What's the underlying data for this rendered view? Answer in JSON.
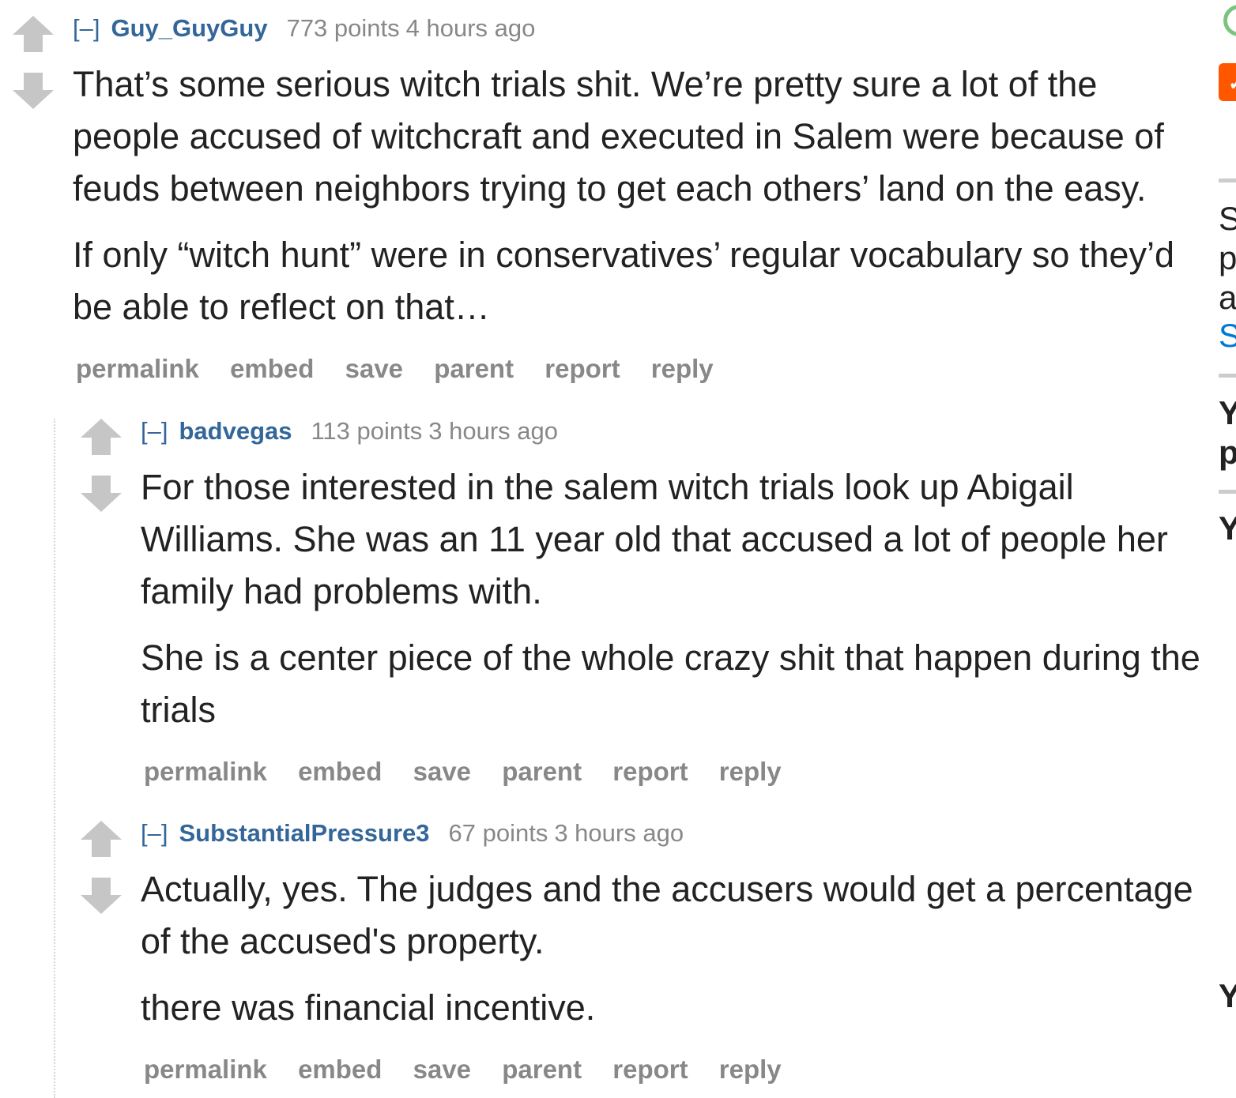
{
  "comments": [
    {
      "expand": "[–]",
      "author": "Guy_GuyGuy",
      "score": "773 points",
      "time": "4 hours ago",
      "paragraphs": [
        "That’s some serious witch trials shit. We’re pretty sure a lot of the people accused of witchcraft and executed in Salem were because of feuds between neighbors trying to get each others’ land on the easy.",
        "If only “witch hunt” were in conservatives’ regular vocabulary so they’d be able to reflect on that…"
      ],
      "buttons": [
        "permalink",
        "embed",
        "save",
        "parent",
        "report",
        "reply"
      ]
    },
    {
      "expand": "[–]",
      "author": "badvegas",
      "score": "113 points",
      "time": "3 hours ago",
      "paragraphs": [
        "For those interested in the salem witch trials look up Abigail Williams. She was an 11 year old that accused a lot of people her family had problems with.",
        "She is a center piece of the whole crazy shit that happen during the trials"
      ],
      "buttons": [
        "permalink",
        "embed",
        "save",
        "parent",
        "report",
        "reply"
      ]
    },
    {
      "expand": "[–]",
      "author": "SubstantialPressure3",
      "score": "67 points",
      "time": "3 hours ago",
      "paragraphs": [
        "Actually, yes. The judges and the accusers would get a percentage of the accused's property.",
        "there was financial incentive."
      ],
      "buttons": [
        "permalink",
        "embed",
        "save",
        "parent",
        "report",
        "reply"
      ]
    }
  ],
  "sidebar": {
    "check_icon": "✓",
    "fragments": [
      "S",
      "p",
      "a",
      "S",
      "Y",
      "p",
      "Y",
      "Y"
    ]
  },
  "colors": {
    "author": "#336699",
    "meta": "#888888",
    "body": "#222222",
    "arrow": "#c6c6c6",
    "sidebar_accent": "#ff5700",
    "sidebar_link": "#0079d3"
  },
  "icons": {
    "upvote": "upvote-arrow-icon",
    "downvote": "downvote-arrow-icon"
  }
}
